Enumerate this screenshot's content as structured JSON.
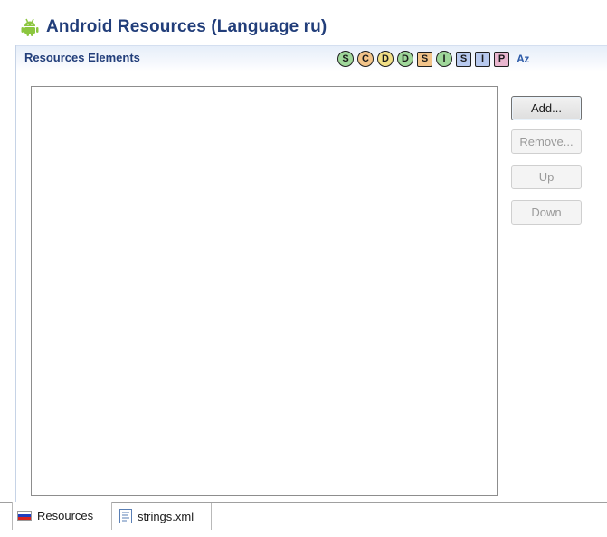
{
  "editor": {
    "title": "Android Resources (Language ru)",
    "icon": "android-icon"
  },
  "section": {
    "title": "Resources Elements",
    "toolbar": [
      {
        "label": "S",
        "icon": "string-icon",
        "shape": "circle",
        "color": "#9fd79a"
      },
      {
        "label": "C",
        "icon": "color-icon",
        "shape": "circle",
        "color": "#f2c48a"
      },
      {
        "label": "D",
        "icon": "dimension-icon",
        "shape": "circle",
        "color": "#f1df86"
      },
      {
        "label": "D",
        "icon": "drawable-icon",
        "shape": "circle",
        "color": "#9fd79a"
      },
      {
        "label": "S",
        "icon": "style-icon",
        "shape": "square",
        "color": "#f2c48a"
      },
      {
        "label": "I",
        "icon": "item-icon",
        "shape": "circle",
        "color": "#9fd79a"
      },
      {
        "label": "S",
        "icon": "string-array-icon",
        "shape": "square",
        "color": "#b7c9ee"
      },
      {
        "label": "I",
        "icon": "integer-array-icon",
        "shape": "square",
        "color": "#b7c9ee"
      },
      {
        "label": "P",
        "icon": "plurals-icon",
        "shape": "square",
        "color": "#e9b6cf"
      },
      {
        "label": "Az",
        "icon": "sort-alpha-icon",
        "shape": "none",
        "color": "#2c5aa8"
      }
    ]
  },
  "buttons": {
    "add": "Add...",
    "remove": "Remove...",
    "up": "Up",
    "down": "Down"
  },
  "tabs": [
    {
      "label": "Resources",
      "icon": "russia-flag-icon",
      "active": true
    },
    {
      "label": "strings.xml",
      "icon": "xml-file-icon",
      "active": false
    }
  ]
}
